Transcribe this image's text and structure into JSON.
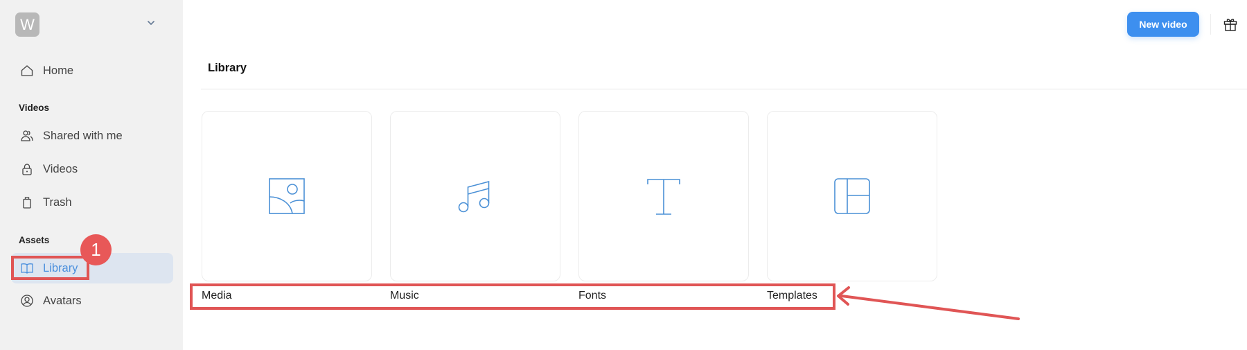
{
  "sidebar": {
    "workspace": {
      "initial": "W",
      "chevron_icon": "chevron-down-icon"
    },
    "items": [
      {
        "label": "Home",
        "icon": "home-icon"
      },
      {
        "label": "Shared with me",
        "icon": "users-icon"
      },
      {
        "label": "Videos",
        "icon": "lock-icon"
      },
      {
        "label": "Trash",
        "icon": "trash-icon"
      },
      {
        "label": "Library",
        "icon": "book-icon",
        "active": true
      },
      {
        "label": "Avatars",
        "icon": "user-circle-icon"
      }
    ],
    "sections": {
      "videos": "Videos",
      "assets": "Assets"
    }
  },
  "topbar": {
    "new_video_label": "New video",
    "gift_icon": "gift-icon"
  },
  "main": {
    "title": "Library",
    "cards": [
      {
        "label": "Media",
        "icon": "image-icon"
      },
      {
        "label": "Music",
        "icon": "music-icon"
      },
      {
        "label": "Fonts",
        "icon": "text-icon"
      },
      {
        "label": "Templates",
        "icon": "layout-icon"
      }
    ]
  },
  "annotations": {
    "badge_number": "1",
    "color": "#e05555"
  }
}
